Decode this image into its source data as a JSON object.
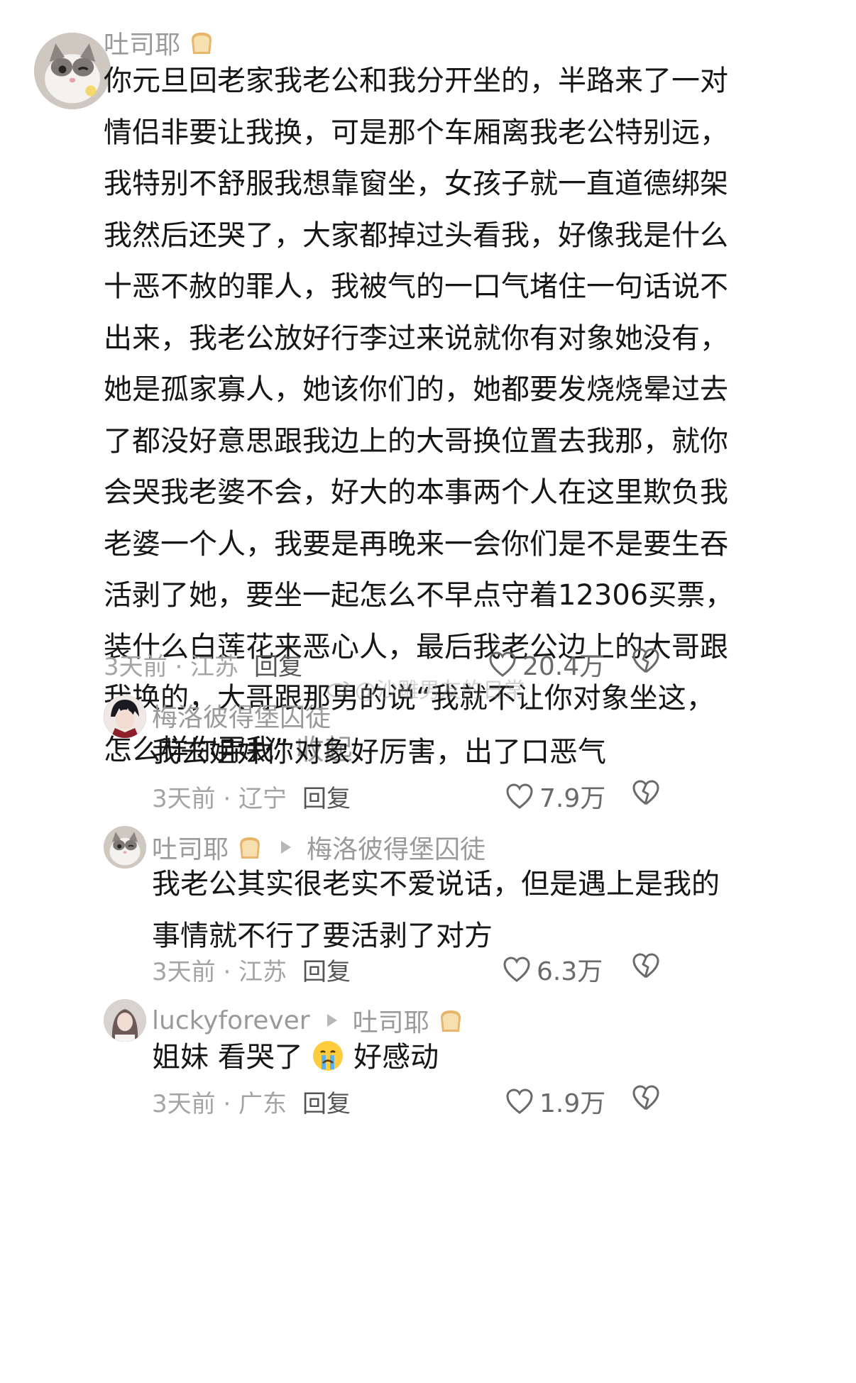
{
  "comments": [
    {
      "author": "吐司耶",
      "body_lines": [
        "你元旦回老家我老公和我分开坐的，半路来了一对",
        "情侣非要让我换，可是那个车厢离我老公特别远，",
        "我特别不舒服我想靠窗坐，女孩子就一直道德绑架",
        "我然后还哭了，大家都掉过头看我，好像我是什么",
        "十恶不赦的罪人，我被气的一口气堵住一句话说不",
        "出来，我老公放好行李过来说就你有对象她没有，",
        "她是孤家寡人，她该你们的，她都要发烧烧晕过去",
        "了都没好意思跟我边上的大哥换位置去我那，就你",
        "会哭我老婆不会，好大的本事两个人在这里欺负我",
        "老婆一个人，我要是再晚来一会你们是不是要生吞",
        "活剥了她，要坐一起怎么不早点守着12306买票，",
        "装什么白莲花来恶心人，最后我老公边上的大哥跟",
        "我换的，大哥跟那男的说“我就不让你对象坐这，",
        "怎么样你弄我”"
      ],
      "collapse_label": "收起",
      "meta": "3天前 · 江苏",
      "reply_label": "回复",
      "likes": "20.4万"
    },
    {
      "author": "梅洛彼得堡囚徒",
      "body_lines": [
        "我去姐妹你对象好厉害，出了口恶气"
      ],
      "meta": "3天前 · 辽宁",
      "reply_label": "回复",
      "likes": "7.9万"
    },
    {
      "author": "吐司耶",
      "reply_to": "梅洛彼得堡囚徒",
      "body_lines": [
        "我老公其实很老实不爱说话，但是遇上是我的",
        "事情就不行了要活剥了对方"
      ],
      "meta": "3天前 · 江苏",
      "reply_label": "回复",
      "likes": "6.3万"
    },
    {
      "author": "luckyforever",
      "reply_to": "吐司耶",
      "body_prefix": "姐妹 看哭了",
      "body_suffix": "好感动",
      "meta": "3天前 · 广东",
      "reply_label": "回复",
      "likes": "1.9万"
    }
  ],
  "watermark": "@沙雕男友的日常",
  "icons": {
    "like": "heart-outline-icon",
    "dislike": "broken-heart-icon",
    "author_badge": "bread-emoji-icon",
    "emoji": "crying-face-emoji-icon"
  },
  "colors": {
    "text": "#161616",
    "muted": "#9a9a9a",
    "reply": "#555555"
  }
}
